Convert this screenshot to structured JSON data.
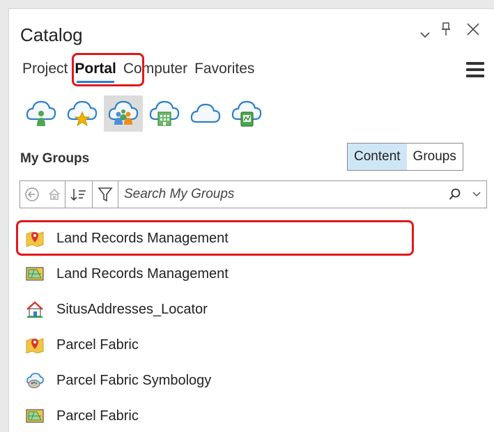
{
  "pane": {
    "title": "Catalog",
    "header_buttons": [
      "options-dropdown",
      "pin",
      "close"
    ]
  },
  "tabs": [
    {
      "label": "Project",
      "active": false
    },
    {
      "label": "Portal",
      "active": true
    },
    {
      "label": "Computer",
      "active": false
    },
    {
      "label": "Favorites",
      "active": false
    }
  ],
  "portal_icons": [
    {
      "icon": "my-content-cloud-icon",
      "selected": false
    },
    {
      "icon": "my-favorites-cloud-icon",
      "selected": false
    },
    {
      "icon": "my-groups-cloud-icon",
      "selected": true
    },
    {
      "icon": "my-organization-cloud-icon",
      "selected": false
    },
    {
      "icon": "arcgis-online-cloud-icon",
      "selected": false
    },
    {
      "icon": "living-atlas-cloud-icon",
      "selected": false
    }
  ],
  "section": {
    "label": "My Groups",
    "toggle": {
      "content": "Content",
      "groups": "Groups",
      "active": "Content"
    }
  },
  "search": {
    "placeholder": "Search My Groups",
    "value": ""
  },
  "items": [
    {
      "label": "Land Records Management",
      "icon": "map-pin-folder-icon",
      "highlighted": true
    },
    {
      "label": "Land Records Management",
      "icon": "map-package-icon",
      "highlighted": false
    },
    {
      "label": "SitusAddresses_Locator",
      "icon": "locator-house-icon",
      "highlighted": false
    },
    {
      "label": "Parcel Fabric",
      "icon": "map-pin-folder-icon",
      "highlighted": false
    },
    {
      "label": "Parcel Fabric Symbology",
      "icon": "style-palette-icon",
      "highlighted": false
    },
    {
      "label": "Parcel Fabric",
      "icon": "map-package-icon",
      "highlighted": false
    }
  ],
  "colors": {
    "accent": "#2b7bd2",
    "highlight_red": "#e0181b",
    "toggle_on": "#cfe6f7"
  }
}
